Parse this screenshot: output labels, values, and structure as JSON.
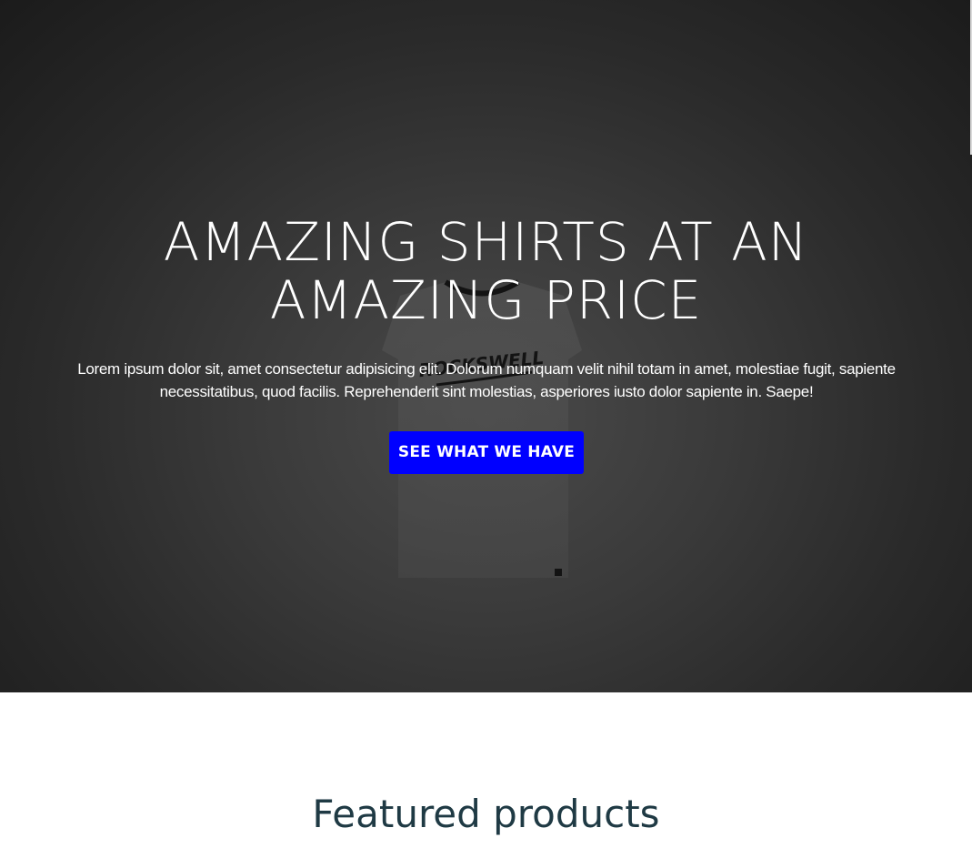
{
  "hero": {
    "title_line1": "AMAZING SHIRTS AT AN",
    "title_line2": "AMAZING PRICE",
    "description": "Lorem ipsum dolor sit, amet consectetur adipisicing elit. Dolorum numquam velit nihil totam in amet, molestiae fugit, sapiente necessitatibus, quod facilis. Reprehenderit sint molestias, asperiores iusto dolor sapiente in. Saepe!",
    "cta_label": "SEE WHAT WE HAVE",
    "shirt_brand": "ROCKSWELL"
  },
  "featured": {
    "title": "Featured products"
  },
  "colors": {
    "cta_background": "#0000ff",
    "hero_background": "#2a2a2a",
    "featured_title": "#1f3a44"
  },
  "icons": {
    "hero_image": "t-shirt-image"
  }
}
